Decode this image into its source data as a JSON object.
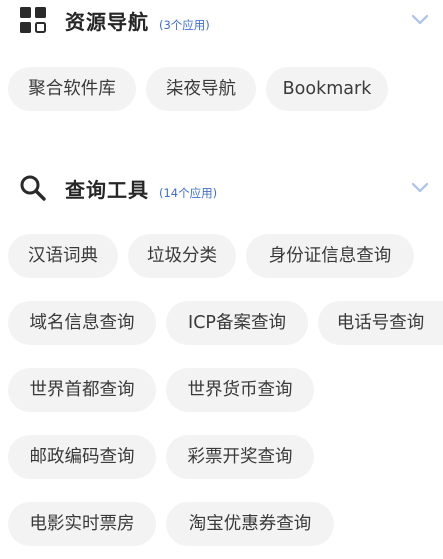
{
  "sections": [
    {
      "title": "资源导航",
      "count": "(3个应用)",
      "icon": "grid-apps-icon",
      "apps": [
        "聚合软件库",
        "柒夜导航",
        "Bookmark"
      ]
    },
    {
      "title": "查询工具",
      "count": "(14个应用)",
      "icon": "search-icon",
      "apps": [
        "汉语词典",
        "垃圾分类",
        "身份证信息查询",
        "域名信息查询",
        "ICP备案查询",
        "电话号查询",
        "世界首都查询",
        "世界货币查询",
        "邮政编码查询",
        "彩票开奖查询",
        "电影实时票房",
        "淘宝优惠券查询"
      ]
    }
  ],
  "colors": {
    "chip_bg": "#f3f3f3",
    "count_text": "#3f6fd0",
    "chevron": "#a9c3ea",
    "icon": "#2a2a2a"
  }
}
